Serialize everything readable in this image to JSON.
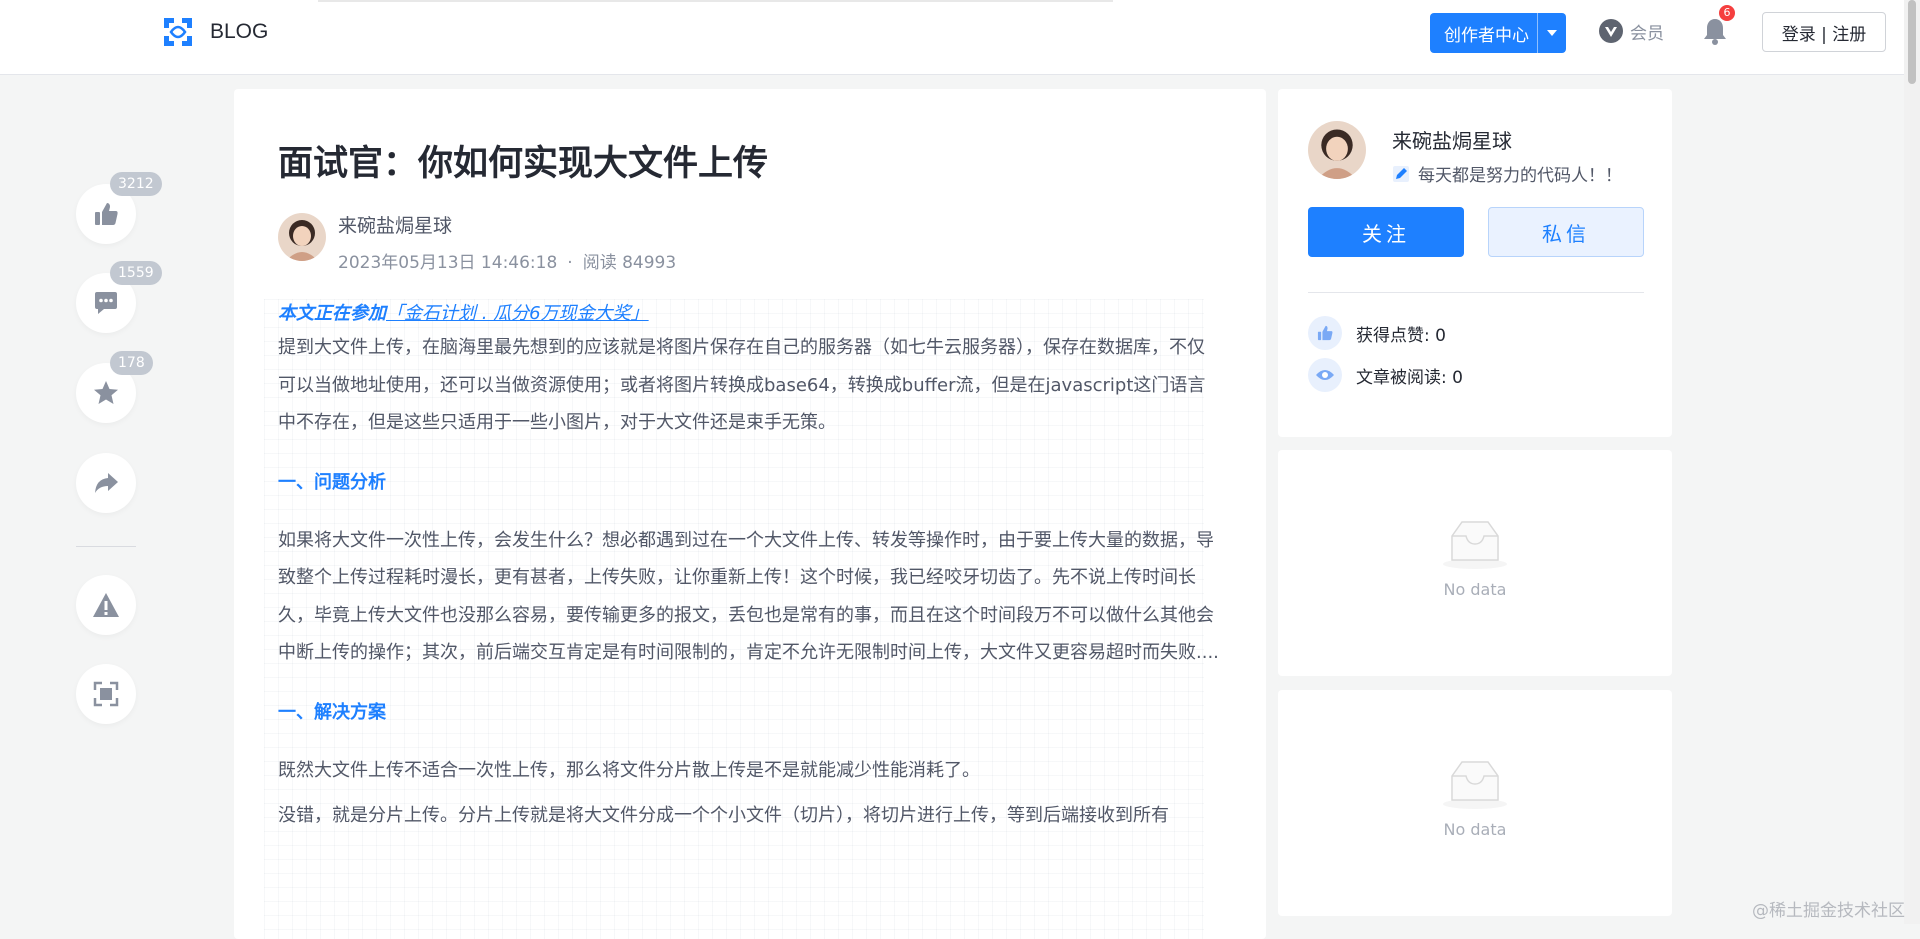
{
  "header": {
    "brand": "BLOG",
    "creator_center": "创作者中心",
    "vip": "会员",
    "notification_count": "6",
    "login": "登录 | 注册"
  },
  "actions": {
    "like_count": "3212",
    "comment_count": "1559",
    "collect_count": "178"
  },
  "article": {
    "title": "面试官：你如何实现大文件上传",
    "author": "来碗盐焗星球",
    "date": "2023年05月13日 14:46:18",
    "dot": "·",
    "views": "阅读 84993",
    "promo_prefix": "本文正在参加",
    "promo_link": "「金石计划 . 瓜分6万现金大奖」",
    "p1": "提到大文件上传，在脑海里最先想到的应该就是将图片保存在自己的服务器（如七牛云服务器），保存在数据库，不仅可以当做地址使用，还可以当做资源使用；或者将图片转换成base64，转换成buffer流，但是在javascript这门语言中不存在，但是这些只适用于一些小图片，对于大文件还是束手无策。",
    "h1": "一、问题分析",
    "p2": "如果将大文件一次性上传，会发生什么？想必都遇到过在一个大文件上传、转发等操作时，由于要上传大量的数据，导致整个上传过程耗时漫长，更有甚者，上传失败，让你重新上传！这个时候，我已经咬牙切齿了。先不说上传时间长久，毕竟上传大文件也没那么容易，要传输更多的报文，丢包也是常有的事，而且在这个时间段万不可以做什么其他会中断上传的操作；其次，前后端交互肯定是有时间限制的，肯定不允许无限制时间上传，大文件又更容易超时而失败....",
    "h2": "一、解决方案",
    "p3": "既然大文件上传不适合一次性上传，那么将文件分片散上传是不是就能减少性能消耗了。",
    "p4": "没错，就是分片上传。分片上传就是将大文件分成一个个小文件（切片），将切片进行上传，等到后端接收到所有"
  },
  "sidebar": {
    "author": "来碗盐焗星球",
    "motto": "每天都是努力的代码人！！",
    "follow": "关注",
    "message": "私信",
    "likes_label": "获得点赞: 0",
    "reads_label": "文章被阅读: 0",
    "empty1": "No data",
    "empty2": "No data"
  },
  "watermark": "@稀土掘金技术社区",
  "colors": {
    "accent": "#1e80ff",
    "badge": "#f53f3f"
  }
}
